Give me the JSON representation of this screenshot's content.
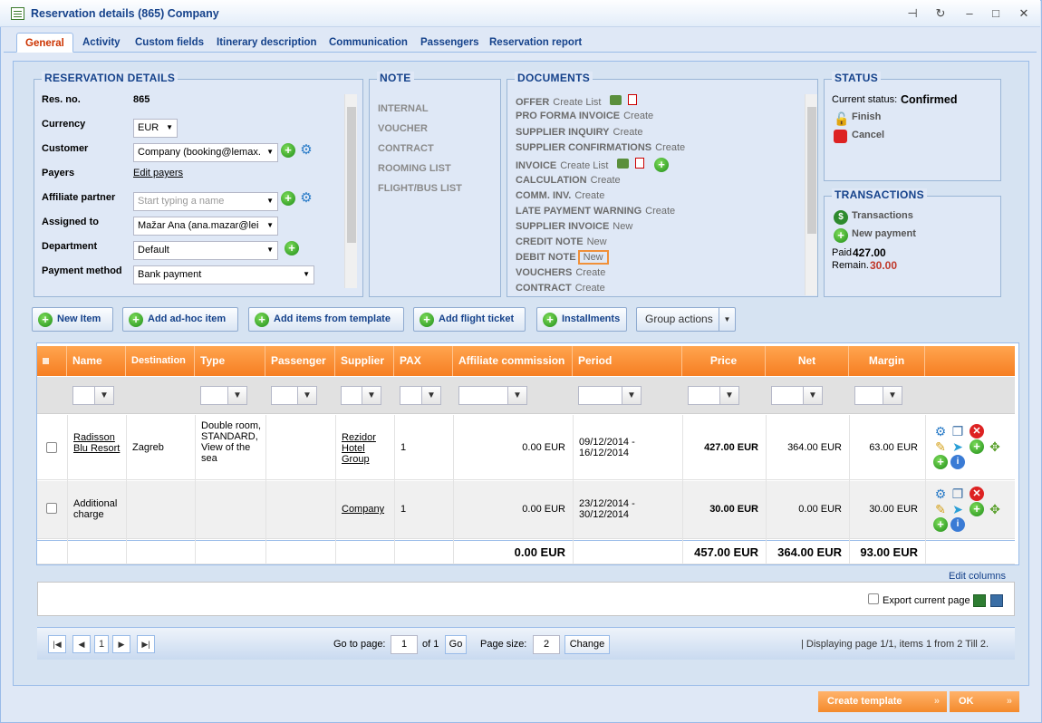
{
  "window": {
    "title": "Reservation details (865) Company"
  },
  "tabs": [
    "General",
    "Activity",
    "Custom fields",
    "Itinerary description",
    "Communication",
    "Passengers",
    "Reservation report"
  ],
  "reservation": {
    "legend": "RESERVATION DETAILS",
    "res_no_label": "Res. no.",
    "res_no": "865",
    "currency_label": "Currency",
    "currency": "EUR",
    "customer_label": "Customer",
    "customer": "Company (booking@lemax.",
    "payers_label": "Payers",
    "payers_link": "Edit payers",
    "affiliate_label": "Affiliate partner",
    "affiliate_placeholder": "Start typing a name",
    "assigned_label": "Assigned to",
    "assigned": "Mažar Ana (ana.mazar@lei",
    "department_label": "Department",
    "department": "Default",
    "payment_label": "Payment method",
    "payment": "Bank payment"
  },
  "note": {
    "legend": "NOTE",
    "items": [
      "INTERNAL",
      "VOUCHER",
      "CONTRACT",
      "ROOMING LIST",
      "FLIGHT/BUS LIST"
    ]
  },
  "documents": {
    "legend": "DOCUMENTS",
    "rows": [
      {
        "name": "OFFER",
        "actions": "Create  List"
      },
      {
        "name": "PRO FORMA INVOICE",
        "actions": "Create"
      },
      {
        "name": "SUPPLIER INQUIRY",
        "actions": "Create"
      },
      {
        "name": "SUPPLIER CONFIRMATIONS",
        "actions": "Create"
      },
      {
        "name": "INVOICE",
        "actions": "Create  List"
      },
      {
        "name": "CALCULATION",
        "actions": "Create"
      },
      {
        "name": "COMM. INV.",
        "actions": "Create"
      },
      {
        "name": "LATE PAYMENT WARNING",
        "actions": "Create"
      },
      {
        "name": "SUPPLIER INVOICE",
        "actions": "New"
      },
      {
        "name": "CREDIT NOTE",
        "actions": "New"
      },
      {
        "name": "DEBIT NOTE",
        "actions": "New"
      },
      {
        "name": "VOUCHERS",
        "actions": "Create"
      },
      {
        "name": "CONTRACT",
        "actions": "Create"
      }
    ]
  },
  "status": {
    "legend": "STATUS",
    "current_label": "Current status:",
    "current": "Confirmed",
    "finish": "Finish",
    "cancel": "Cancel"
  },
  "transactions": {
    "legend": "TRANSACTIONS",
    "transactions": "Transactions",
    "new_payment": "New payment",
    "paid_label": "Paid",
    "paid": "427.00",
    "remain_label": "Remain.",
    "remain": "30.00"
  },
  "actions": {
    "new_item": "New Item",
    "add_adhoc": "Add ad-hoc item",
    "add_template": "Add items from template",
    "add_flight": "Add flight ticket",
    "installments": "Installments",
    "group_actions": "Group actions"
  },
  "grid": {
    "columns": [
      "Name",
      "Destination",
      "Type",
      "Passenger",
      "Supplier",
      "PAX",
      "Affiliate commission",
      "Period",
      "Price",
      "Net",
      "Margin"
    ],
    "rows": [
      {
        "name": "Radisson Blu Resort",
        "destination": "Zagreb",
        "type": "Double room, STANDARD, View of the sea",
        "passenger": "",
        "supplier": "Rezidor Hotel Group",
        "pax": "1",
        "commission": "0.00 EUR",
        "period": "09/12/2014 - 16/12/2014",
        "price": "427.00 EUR",
        "net": "364.00 EUR",
        "margin": "63.00 EUR"
      },
      {
        "name": "Additional charge",
        "destination": "",
        "type": "",
        "passenger": "",
        "supplier": "Company",
        "pax": "1",
        "commission": "0.00 EUR",
        "period": "23/12/2014 - 30/12/2014",
        "price": "30.00 EUR",
        "net": "0.00 EUR",
        "margin": "30.00 EUR"
      }
    ],
    "totals": {
      "commission": "0.00 EUR",
      "price": "457.00 EUR",
      "net": "364.00 EUR",
      "margin": "93.00 EUR"
    },
    "edit_columns": "Edit columns",
    "export_label": "Export current page"
  },
  "pager": {
    "page": "1",
    "goto_label": "Go to page:",
    "goto_value": "1",
    "of": "of 1",
    "go": "Go",
    "size_label": "Page size:",
    "size": "2",
    "change": "Change",
    "info": "| Displaying page  1/1,  items  1  from  2  Till  2."
  },
  "footer": {
    "create_template": "Create template",
    "ok": "OK"
  },
  "colors": {
    "accent": "#f67e22",
    "title": "#15428b",
    "remain": "#c0392b"
  }
}
